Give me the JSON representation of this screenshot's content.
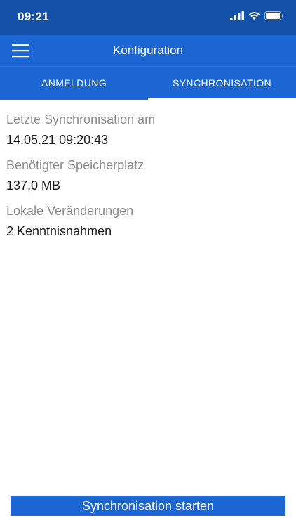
{
  "status_bar": {
    "time": "09:21",
    "icons": [
      "cellular-signal-icon",
      "wifi-icon",
      "battery-icon"
    ]
  },
  "nav": {
    "title": "Konfiguration",
    "menu_icon": "hamburger-menu-icon"
  },
  "tabs": [
    {
      "label": "ANMELDUNG",
      "selected": false
    },
    {
      "label": "SYNCHRONISATION",
      "selected": true
    }
  ],
  "fields": [
    {
      "label": "Letzte Synchronisation am",
      "value": "14.05.21 09:20:43"
    },
    {
      "label": "Benötigter Speicherplatz",
      "value": "137,0 MB"
    },
    {
      "label": "Lokale Veränderungen",
      "value": "2 Kenntnisnahmen"
    }
  ],
  "action_button": {
    "label": "Synchronisation starten"
  },
  "colors": {
    "status_bar": "#1350a8",
    "primary": "#1c66d4",
    "label_text": "#8a8a8e",
    "value_text": "#1d1d1f"
  }
}
